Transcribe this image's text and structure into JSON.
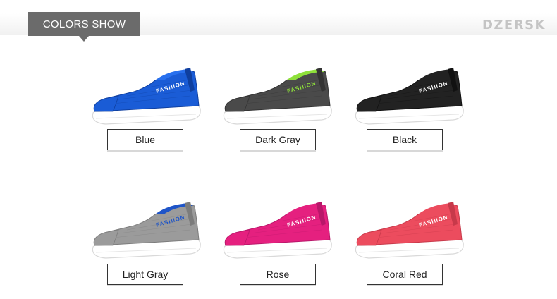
{
  "header": {
    "tab_label": "COLORS SHOW",
    "brand": "DZERSK"
  },
  "shoe_text": "FASHION",
  "products": [
    {
      "label": "Blue",
      "upper": "#1a5cd6",
      "upper_dark": "#0f3f9f",
      "toe": "#1a5cd6",
      "collar": "#2870ee",
      "logo": "#ffffff"
    },
    {
      "label": "Dark Gray",
      "upper": "#4a4a4a",
      "upper_dark": "#333333",
      "toe": "#4a4a4a",
      "collar": "#8ee03a",
      "logo": "#8ee03a"
    },
    {
      "label": "Black",
      "upper": "#222222",
      "upper_dark": "#111111",
      "toe": "#222222",
      "collar": "#222222",
      "logo": "#ffffff"
    },
    {
      "label": "Light Gray",
      "upper": "#9b9b9b",
      "upper_dark": "#7c7c7c",
      "toe": "#9b9b9b",
      "collar": "#1f55c8",
      "logo": "#1f55c8"
    },
    {
      "label": "Rose",
      "upper": "#e5207f",
      "upper_dark": "#b9176a",
      "toe": "#e5207f",
      "collar": "#e5207f",
      "logo": "#ffffff"
    },
    {
      "label": "Coral Red",
      "upper": "#ec4c5e",
      "upper_dark": "#c7394a",
      "toe": "#ec4c5e",
      "collar": "#ec4c5e",
      "logo": "#ffffff"
    }
  ]
}
